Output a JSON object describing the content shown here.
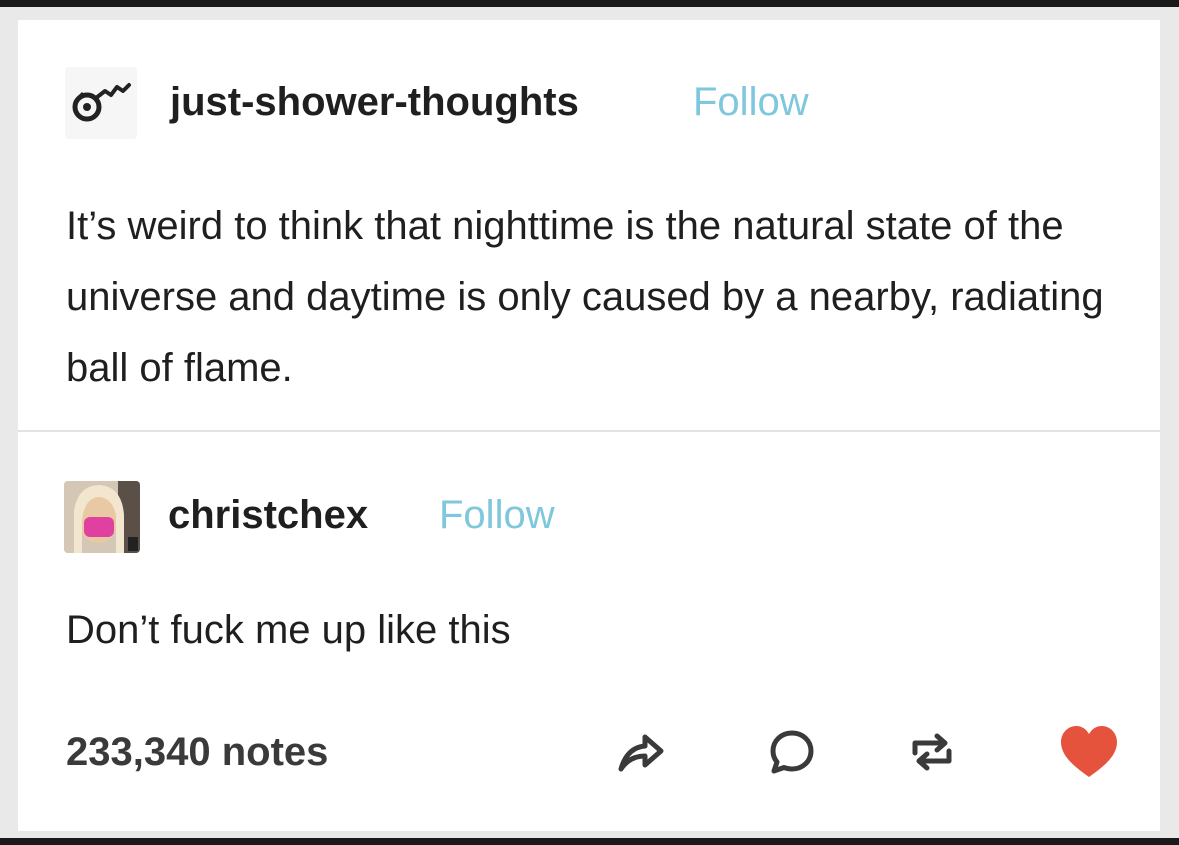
{
  "posts": [
    {
      "username": "just-shower-thoughts",
      "follow_label": "Follow",
      "text": "It’s weird to think that nighttime is the natural state of the universe and daytime is only caused by a nearby, radiating ball of flame."
    },
    {
      "username": "christchex",
      "follow_label": "Follow",
      "text": "Don’t fuck me up like this"
    }
  ],
  "footer": {
    "notes": "233,340 notes"
  },
  "icons": {
    "share": "share-icon",
    "comment": "comment-icon",
    "reblog": "reblog-icon",
    "like": "heart-icon"
  },
  "colors": {
    "follow": "#7fc7dc",
    "heart": "#e5533c",
    "text": "#1f1f1f"
  }
}
